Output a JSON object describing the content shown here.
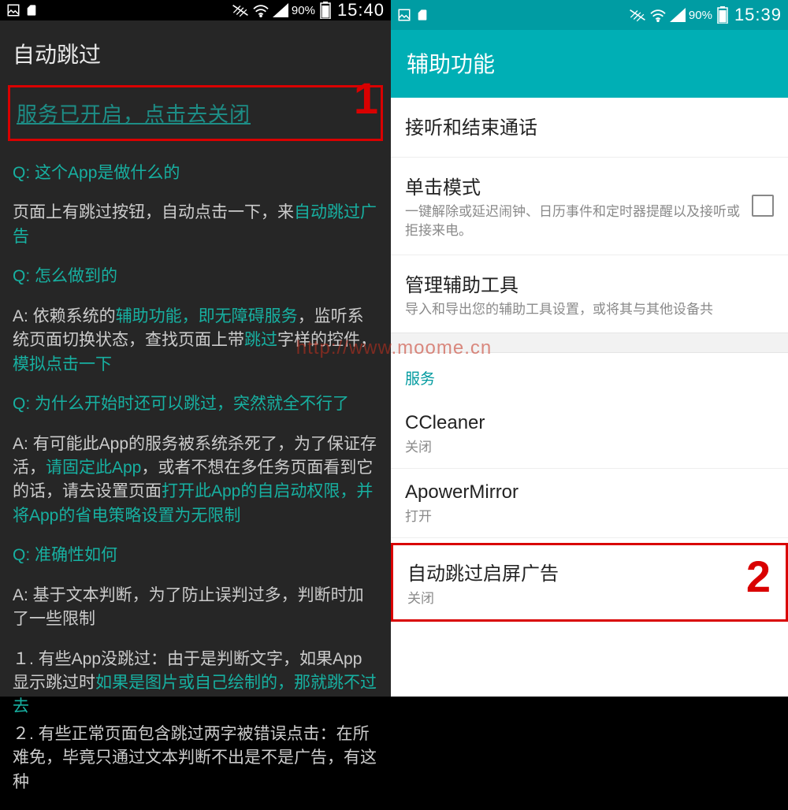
{
  "left": {
    "statusbar": {
      "battery_pct": "90%",
      "time": "15:40"
    },
    "title": "自动跳过",
    "service_link": "服务已开启，点击去关闭",
    "marker": "1",
    "faq": {
      "q1": "Q: 这个App是做什么的",
      "a1_pre": "页面上有跳过按钮，自动点击一下，来",
      "a1_link": "自动跳过广告",
      "q2": "Q: 怎么做到的",
      "a2_pre": "A: 依赖系统的",
      "a2_l1": "辅助功能，即无障碍服务",
      "a2_mid": "，监听系统页面切换状态，查找页面上带",
      "a2_l2": "跳过",
      "a2_mid2": "字样的控件，",
      "a2_l3": "模拟点击一下",
      "q3": "Q: 为什么开始时还可以跳过，突然就全不行了",
      "a3_pre": "A: 有可能此App的服务被系统杀死了，为了保证存活，",
      "a3_l1": "请固定此App",
      "a3_mid": "，或者不想在多任务页面看到它的话，请去设置页面",
      "a3_l2": "打开此App的自启动权限，并将App的省电策略设置为无限制",
      "q4": "Q: 准确性如何",
      "a4_pre": "A: 基于文本判断，为了防止误判过多，判断时加了一些限制",
      "a4_li1_pre": "１. 有些App没跳过：由于是判断文字，如果App显示跳过时",
      "a4_li1_link": "如果是图片或自己绘制的，那就跳不过去",
      "a4_li2": "２. 有些正常页面包含跳过两字被错误点击：在所难免，毕竟只通过文本判断不出是不是广告，有这种"
    }
  },
  "right": {
    "statusbar": {
      "battery_pct": "90%",
      "time": "15:39"
    },
    "header": "辅助功能",
    "items": {
      "answer_calls": "接听和结束通话",
      "single_tap_title": "单击模式",
      "single_tap_sub": "一键解除或延迟闹钟、日历事件和定时器提醒以及接听或拒接来电。",
      "manage_title": "管理辅助工具",
      "manage_sub": "导入和导出您的辅助工具设置，或将其与其他设备共"
    },
    "section_label": "服务",
    "marker": "2",
    "services": [
      {
        "name": "CCleaner",
        "status": "关闭"
      },
      {
        "name": "ApowerMirror",
        "status": "打开"
      },
      {
        "name": "自动跳过启屏广告",
        "status": "关闭"
      }
    ]
  },
  "watermark": "http://www.moome.cn"
}
